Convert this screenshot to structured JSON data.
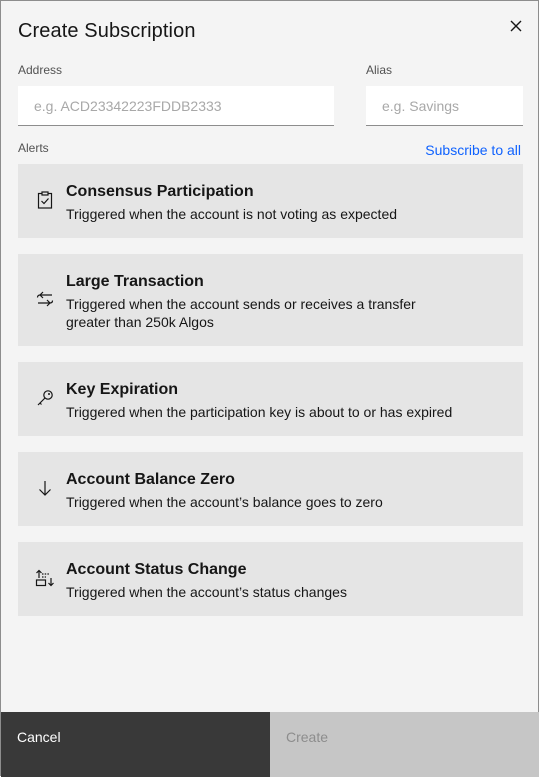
{
  "modal": {
    "title": "Create Subscription",
    "close_icon": "close-icon"
  },
  "form": {
    "address_label": "Address",
    "address_placeholder": "e.g. ACD23342223FDDB2333",
    "address_value": "",
    "alias_label": "Alias",
    "alias_placeholder": "e.g. Savings",
    "alias_value": ""
  },
  "alerts": {
    "label": "Alerts",
    "subscribe_all_label": "Subscribe to all",
    "items": [
      {
        "title": "Consensus Participation",
        "description": "Triggered when the account is not voting as expected",
        "icon": "clipboard-check-icon"
      },
      {
        "title": "Large Transaction",
        "description": "Triggered when the account sends or receives a transfer greater than 250k Algos",
        "icon": "arrows-swap-icon"
      },
      {
        "title": "Key Expiration",
        "description": "Triggered when the participation key is about to or has expired",
        "icon": "key-icon"
      },
      {
        "title": "Account Balance Zero",
        "description": "Triggered when the account’s balance goes to zero",
        "icon": "arrow-down-icon"
      },
      {
        "title": "Account Status Change",
        "description": "Triggered when the account’s status changes",
        "icon": "status-change-icon"
      }
    ]
  },
  "footer": {
    "cancel_label": "Cancel",
    "create_label": "Create"
  },
  "colors": {
    "link": "#0f62fe",
    "card_bg": "#e5e5e5",
    "modal_bg": "#f4f4f4",
    "cancel_bg": "#393939",
    "create_disabled_bg": "#c6c6c6"
  }
}
